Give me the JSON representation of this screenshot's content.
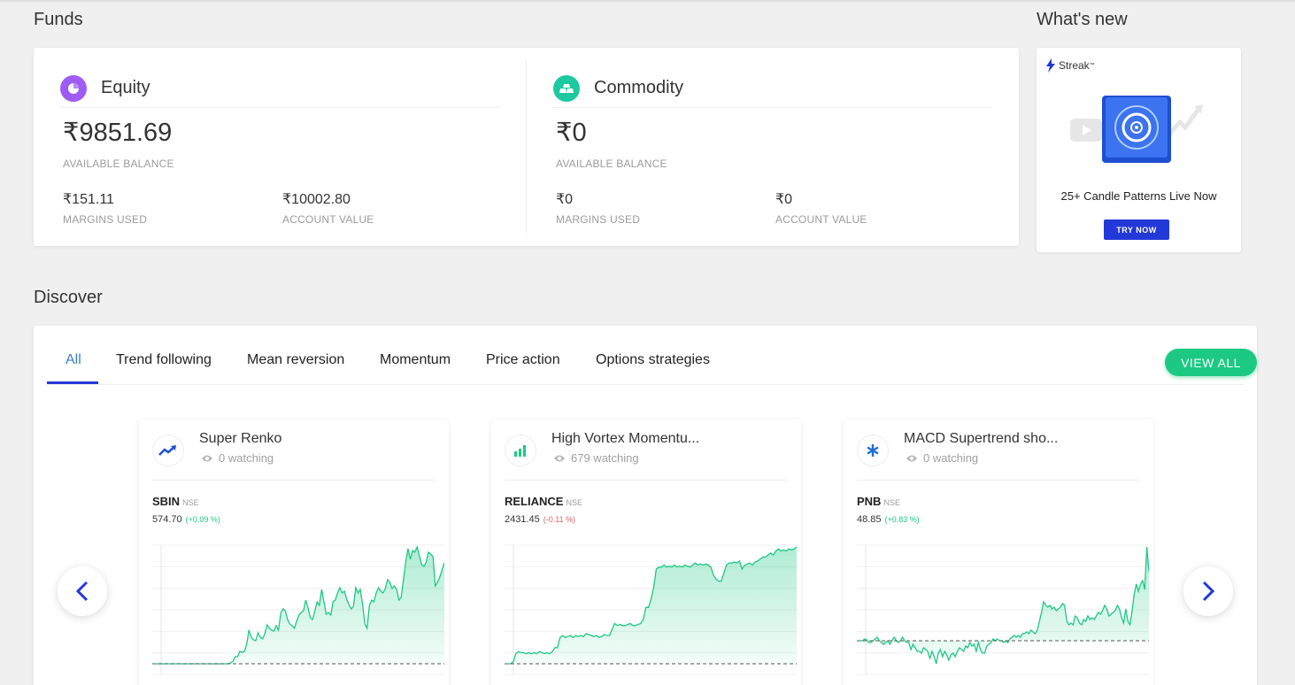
{
  "funds": {
    "title": "Funds",
    "equity": {
      "name": "Equity",
      "balance": "₹9851.69",
      "balance_label": "AVAILABLE BALANCE",
      "margins_used": "₹151.11",
      "margins_label": "MARGINS USED",
      "account_value": "₹10002.80",
      "account_label": "ACCOUNT VALUE",
      "icon": "pie-chart-icon",
      "color": "#9f5cf5"
    },
    "commodity": {
      "name": "Commodity",
      "balance": "₹0",
      "balance_label": "AVAILABLE BALANCE",
      "margins_used": "₹0",
      "margins_label": "MARGINS USED",
      "account_value": "₹0",
      "account_label": "ACCOUNT VALUE",
      "icon": "gold-bars-icon",
      "color": "#1cc9a0"
    }
  },
  "whats_new": {
    "title": "What's new",
    "brand": "Streak",
    "brand_tm": "™",
    "promo_text": "25+ Candle Patterns Live Now",
    "cta": "TRY NOW"
  },
  "discover": {
    "title": "Discover",
    "tabs": [
      {
        "label": "All",
        "active": true
      },
      {
        "label": "Trend following"
      },
      {
        "label": "Mean reversion"
      },
      {
        "label": "Momentum"
      },
      {
        "label": "Price action"
      },
      {
        "label": "Options strategies"
      }
    ],
    "view_all": "VIEW ALL",
    "strategies": [
      {
        "name": "Super Renko",
        "watching": "0 watching",
        "icon": "trending-up-icon",
        "symbol": "SBIN",
        "exchange": "NSE",
        "price": "574.70",
        "change": "(+0.09 %)",
        "direction": "up",
        "series": [
          0,
          0,
          0,
          0,
          0,
          0,
          0,
          0,
          0,
          0,
          0,
          0,
          0,
          0,
          0,
          0,
          0,
          0,
          0,
          0,
          0,
          0,
          0,
          0,
          0,
          0,
          0,
          0,
          0,
          0,
          0,
          0,
          0,
          1,
          3,
          8,
          8,
          14,
          13,
          14,
          22,
          38,
          30,
          27,
          26,
          35,
          30,
          28,
          34,
          44,
          40,
          38,
          37,
          43,
          38,
          57,
          62,
          60,
          50,
          45,
          43,
          40,
          48,
          55,
          58,
          60,
          72,
          63,
          52,
          50,
          60,
          70,
          66,
          84,
          70,
          56,
          58,
          55,
          70,
          72,
          80,
          86,
          80,
          82,
          73,
          67,
          62,
          65,
          86,
          80,
          84,
          67,
          45,
          40,
          66,
          72,
          70,
          80,
          86,
          82,
          80,
          85,
          95,
          92,
          85,
          88,
          84,
          72,
          75,
          95,
          115,
          130,
          118,
          128,
          126,
          132,
          122,
          112,
          110,
          115,
          126,
          124,
          121,
          88,
          92,
          98,
          106,
          114
        ]
      },
      {
        "name": "High Vortex Momentu...",
        "watching": "679 watching",
        "icon": "bar-chart-icon",
        "symbol": "RELIANCE",
        "exchange": "NSE",
        "price": "2431.45",
        "change": "(-0.11 %)",
        "direction": "down",
        "series": [
          2,
          2,
          4,
          12,
          14,
          13,
          13,
          12,
          13,
          12,
          13,
          12,
          14,
          13,
          12,
          13,
          12,
          14,
          18,
          18,
          28,
          30,
          28,
          29,
          30,
          28,
          30,
          29,
          30,
          29,
          32,
          31,
          30,
          29,
          30,
          28,
          29,
          31,
          30,
          30,
          36,
          42,
          40,
          41,
          40,
          40,
          41,
          42,
          40,
          40,
          41,
          42,
          46,
          58,
          58,
          66,
          78,
          96,
          98,
          98,
          100,
          98,
          99,
          98,
          100,
          98,
          99,
          98,
          100,
          99,
          98,
          100,
          102,
          100,
          101,
          100,
          101,
          100,
          98,
          90,
          86,
          84,
          84,
          92,
          100,
          102,
          102,
          103,
          102,
          104,
          96,
          100,
          101,
          102,
          100,
          103,
          104,
          106,
          108,
          108,
          110,
          112,
          110,
          114,
          116,
          114,
          115,
          114,
          116,
          115,
          116,
          118
        ]
      },
      {
        "name": "MACD Supertrend sho...",
        "watching": "0 watching",
        "icon": "asterisk-icon",
        "symbol": "PNB",
        "exchange": "NSE",
        "price": "48.85",
        "change": "(+0.83 %)",
        "direction": "up",
        "series": [
          40,
          40,
          42,
          41,
          38,
          38,
          40,
          42,
          44,
          40,
          38,
          36,
          38,
          40,
          36,
          40,
          44,
          40,
          38,
          40,
          44,
          40,
          38,
          38,
          30,
          36,
          32,
          28,
          28,
          26,
          32,
          30,
          28,
          20,
          28,
          22,
          14,
          26,
          30,
          22,
          28,
          24,
          18,
          24,
          26,
          22,
          28,
          32,
          30,
          28,
          34,
          32,
          38,
          34,
          36,
          28,
          38,
          30,
          26,
          26,
          34,
          36,
          38,
          42,
          40,
          42,
          40,
          40,
          38,
          40,
          38,
          42,
          44,
          46,
          44,
          46,
          44,
          48,
          48,
          50,
          48,
          52,
          50,
          48,
          52,
          62,
          72,
          84,
          80,
          78,
          80,
          76,
          78,
          74,
          76,
          78,
          82,
          80,
          62,
          58,
          60,
          58,
          68,
          66,
          60,
          58,
          64,
          62,
          68,
          64,
          66,
          64,
          68,
          72,
          70,
          74,
          80,
          76,
          68,
          70,
          72,
          74,
          80,
          76,
          66,
          60,
          76,
          62,
          58,
          74,
          92,
          104,
          96,
          104,
          108,
          98,
          146,
          118
        ]
      }
    ]
  }
}
